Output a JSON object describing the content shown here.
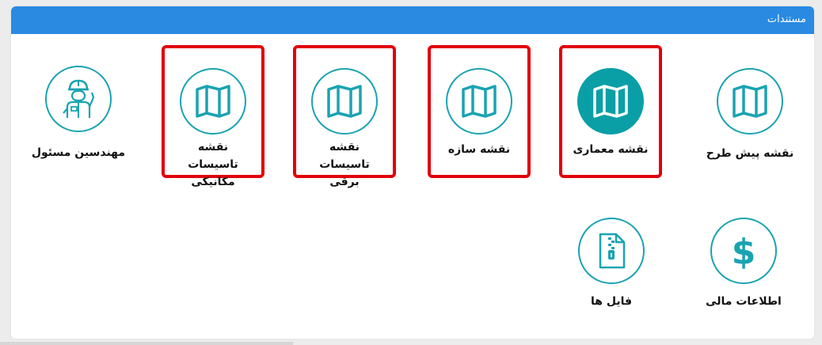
{
  "panel": {
    "title": "مستندات"
  },
  "tiles": [
    {
      "label": "نقشه پیش طرح",
      "icon": "map-icon"
    },
    {
      "label": "نقشه معماری",
      "icon": "map-icon"
    },
    {
      "label": "نقشه سازه",
      "icon": "map-icon"
    },
    {
      "label": "نقشه تاسیسات برقی",
      "icon": "map-icon"
    },
    {
      "label": "نقشه تاسیسات مکانیکی",
      "icon": "map-icon"
    },
    {
      "label": "مهندسین مسئول",
      "icon": "engineer-icon"
    },
    {
      "label": "اطلاعات مالی",
      "icon": "dollar-icon"
    },
    {
      "label": "فایل ها",
      "icon": "zip-file-icon"
    }
  ],
  "colors": {
    "header": "#2a8ae2",
    "icon_teal": "#1aa3b2",
    "highlight_red": "#e2000a"
  }
}
